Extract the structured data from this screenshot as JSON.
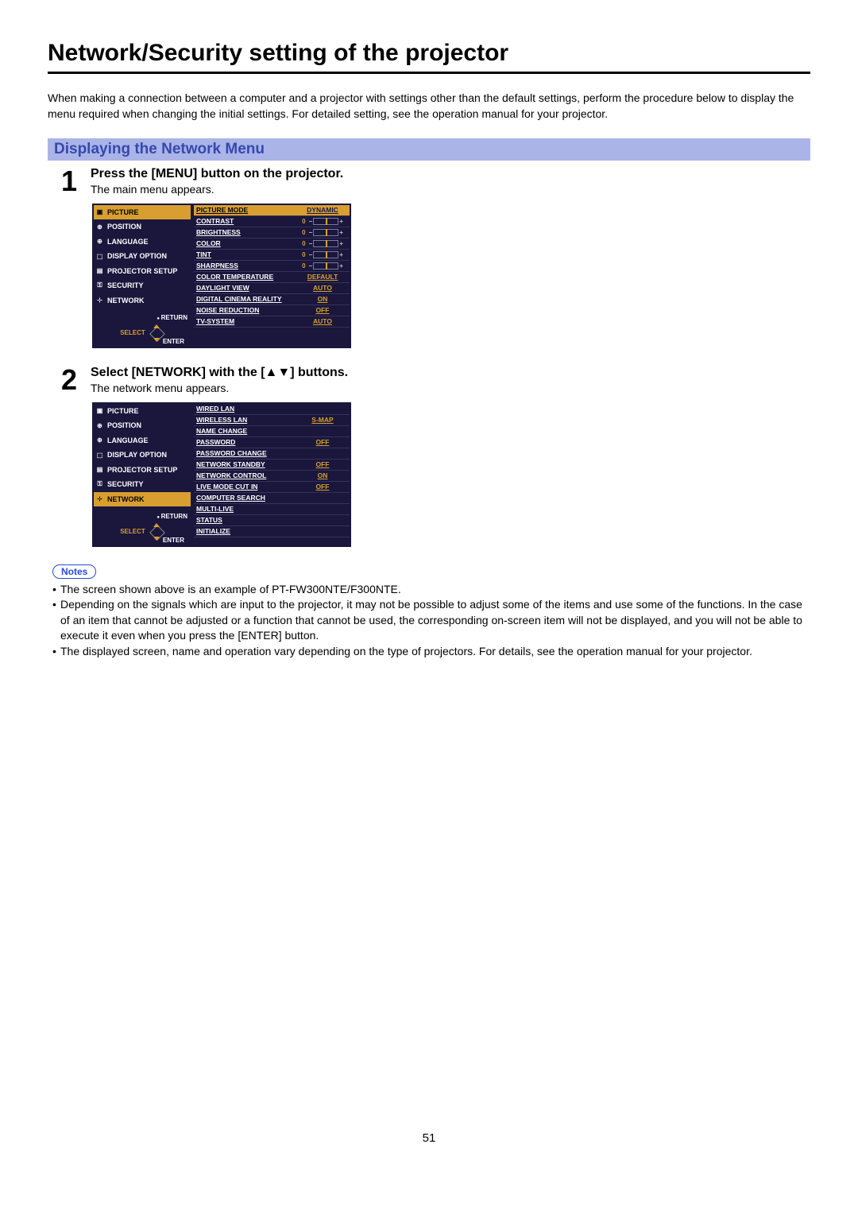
{
  "title": "Network/Security setting of the projector",
  "intro": "When making a connection between a computer and a projector with settings other than the default settings, perform the procedure below to display the menu required when changing the initial settings. For detailed setting, see the operation manual for your projector.",
  "section_heading": "Displaying the Network Menu",
  "steps": [
    {
      "num": "1",
      "title": "Press the [MENU] button on the projector.",
      "sub": "The main menu appears."
    },
    {
      "num": "2",
      "title": "Select [NETWORK] with the [▲▼] buttons.",
      "sub": "The network menu appears."
    }
  ],
  "sidebar_items": [
    "PICTURE",
    "POSITION",
    "LANGUAGE",
    "DISPLAY OPTION",
    "PROJECTOR SETUP",
    "SECURITY",
    "NETWORK"
  ],
  "sidebar_controls": {
    "return_label": "RETURN",
    "select_label": "SELECT",
    "enter_label": "ENTER"
  },
  "main_menu": [
    {
      "label": "PICTURE MODE",
      "value": "DYNAMIC",
      "type": "text",
      "selected": true
    },
    {
      "label": "CONTRAST",
      "value": "0",
      "type": "slider"
    },
    {
      "label": "BRIGHTNESS",
      "value": "0",
      "type": "slider"
    },
    {
      "label": "COLOR",
      "value": "0",
      "type": "slider"
    },
    {
      "label": "TINT",
      "value": "0",
      "type": "slider"
    },
    {
      "label": "SHARPNESS",
      "value": "0",
      "type": "slider"
    },
    {
      "label": "COLOR TEMPERATURE",
      "value": "DEFAULT",
      "type": "text"
    },
    {
      "label": "DAYLIGHT VIEW",
      "value": "AUTO",
      "type": "text"
    },
    {
      "label": "DIGITAL CINEMA REALITY",
      "value": "ON",
      "type": "text"
    },
    {
      "label": "NOISE REDUCTION",
      "value": "OFF",
      "type": "text"
    },
    {
      "label": "TV-SYSTEM",
      "value": "AUTO",
      "type": "text"
    }
  ],
  "network_menu": [
    {
      "label": "WIRED LAN",
      "value": "",
      "type": "none"
    },
    {
      "label": "WIRELESS LAN",
      "value": "S-MAP",
      "type": "text"
    },
    {
      "label": "NAME CHANGE",
      "value": "",
      "type": "none"
    },
    {
      "label": "PASSWORD",
      "value": "OFF",
      "type": "text"
    },
    {
      "label": "PASSWORD CHANGE",
      "value": "",
      "type": "none"
    },
    {
      "label": "NETWORK STANDBY",
      "value": "OFF",
      "type": "text"
    },
    {
      "label": "NETWORK CONTROL",
      "value": "ON",
      "type": "text"
    },
    {
      "label": "LIVE MODE CUT IN",
      "value": "OFF",
      "type": "text"
    },
    {
      "label": "COMPUTER SEARCH",
      "value": "",
      "type": "none"
    },
    {
      "label": "MULTI-LIVE",
      "value": "",
      "type": "none"
    },
    {
      "label": "STATUS",
      "value": "",
      "type": "none"
    },
    {
      "label": "INITIALIZE",
      "value": "",
      "type": "none"
    }
  ],
  "notes_label": "Notes",
  "notes": [
    "The screen shown above is an example of PT-FW300NTE/F300NTE.",
    "Depending on the signals which are input to the projector, it may not be possible to adjust some of the items and use some of the functions. In the case of an item that cannot be adjusted or a function that cannot be used, the corresponding on-screen item will not be displayed, and you will not be able to execute it even when you press the [ENTER] button.",
    "The displayed screen, name and operation vary depending on the type of projectors. For details, see the operation manual for your projector."
  ],
  "page_number": "51"
}
